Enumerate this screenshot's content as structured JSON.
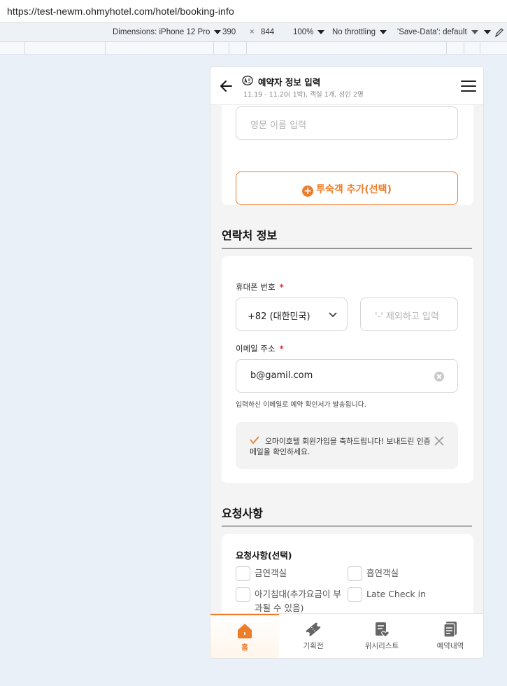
{
  "browser": {
    "url": "https://test-newm.ohmyhotel.com/hotel/booking-info",
    "devtools": {
      "dimensions_label": "Dimensions: iPhone 12 Pro",
      "width": "390",
      "times": "×",
      "height": "844",
      "zoom": "100%",
      "throttling": "No throttling",
      "save_data": "'Save-Data': default"
    }
  },
  "header": {
    "title": "예약자 정보 입력",
    "subtitle": "11.19 - 11.20( 1박), 객실 1개, 성인 2명"
  },
  "guest": {
    "english_name_placeholder": "영문 이름 입력",
    "add_guest_label": "투숙객 추가(선택)"
  },
  "contact": {
    "section_title": "연락처 정보",
    "phone_label": "휴대폰 번호",
    "required_mark": "*",
    "country_code": "+82 (대한민국)",
    "phone_placeholder": "'-' 제외하고 입력",
    "email_label": "이메일 주소",
    "email_value": "b@gamil.com",
    "email_hint": "입력하신 이메일로 예약 확인서가 발송됩니다.",
    "notice": "오마이호텔 회원가입을 축하드립니다! 보내드린 인증 메일을 확인하세요."
  },
  "requests": {
    "section_title": "요청사항",
    "card_title": "요청사항(선택)",
    "options": [
      "금연객실",
      "흡연객실",
      "아기침대(추가요금이 부과될 수 있음)",
      "Late Check in"
    ]
  },
  "tabbar": {
    "items": [
      "홈",
      "기획전",
      "위시리스트",
      "예약내역"
    ]
  },
  "colors": {
    "accent": "#ed7d2b",
    "required": "#e6262c"
  }
}
